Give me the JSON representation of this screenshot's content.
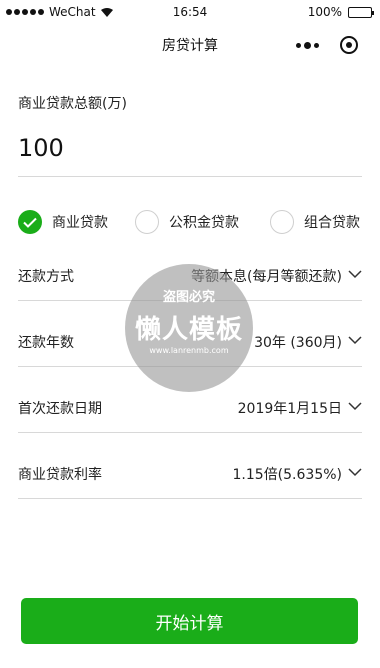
{
  "status_bar": {
    "carrier": "WeChat",
    "time": "16:54",
    "battery": "100%"
  },
  "nav": {
    "title": "房贷计算"
  },
  "loan_amount": {
    "label": "商业贷款总额(万)",
    "value": "100"
  },
  "loan_types": [
    {
      "label": "商业贷款",
      "checked": true
    },
    {
      "label": "公积金贷款",
      "checked": false
    },
    {
      "label": "组合贷款",
      "checked": false
    }
  ],
  "fields": {
    "repayment_method": {
      "label": "还款方式",
      "value": "等额本息(每月等额还款)"
    },
    "repayment_years": {
      "label": "还款年数",
      "value": "30年 (360月)"
    },
    "first_repayment_date": {
      "label": "首次还款日期",
      "value": "2019年1月15日"
    },
    "interest_rate": {
      "label": "商业贷款利率",
      "value": "1.15倍(5.635%)"
    }
  },
  "watermark": {
    "top": "盗图必究",
    "main": "懒人模板",
    "url": "www.lanrenmb.com"
  },
  "start_button": {
    "label": "开始计算"
  },
  "colors": {
    "accent": "#1aad19",
    "divider": "#d8d8d8"
  }
}
